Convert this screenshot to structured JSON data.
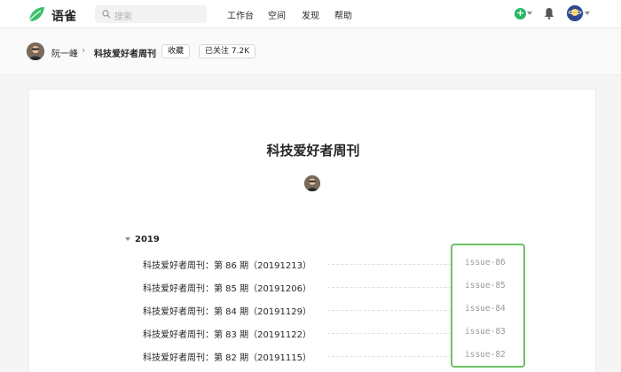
{
  "header": {
    "brand": "语雀",
    "search_placeholder": "搜索",
    "nav": [
      "工作台",
      "空间",
      "发现",
      "帮助"
    ],
    "plus_symbol": "+",
    "brand_color": "#25b864"
  },
  "breadcrumb": {
    "user": "阮一峰",
    "separator": "›",
    "book": "科技爱好者周刊",
    "collect_label": "收藏",
    "follow_label": "已关注",
    "follow_count": "7.2K"
  },
  "book": {
    "title": "科技爱好者周刊",
    "year": "2019",
    "issues": [
      {
        "title": "科技爱好者周刊：第 86 期（20191213）",
        "slug": "issue-86"
      },
      {
        "title": "科技爱好者周刊：第 85 期（20191206）",
        "slug": "issue-85"
      },
      {
        "title": "科技爱好者周刊：第 84 期（20191129）",
        "slug": "issue-84"
      },
      {
        "title": "科技爱好者周刊：第 83 期（20191122）",
        "slug": "issue-83"
      },
      {
        "title": "科技爱好者周刊：第 82 期（20191115）",
        "slug": "issue-82"
      }
    ],
    "highlight_color": "#6cc262"
  }
}
